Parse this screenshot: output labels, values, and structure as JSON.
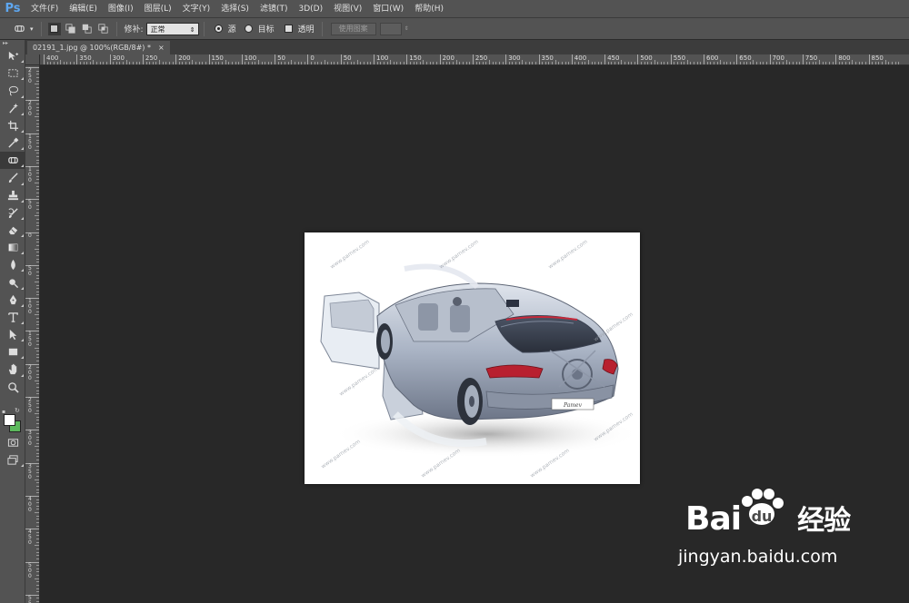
{
  "app": {
    "logo": "Ps",
    "menu": [
      "文件(F)",
      "编辑(E)",
      "图像(I)",
      "图层(L)",
      "文字(Y)",
      "选择(S)",
      "滤镜(T)",
      "3D(D)",
      "视图(V)",
      "窗口(W)",
      "帮助(H)"
    ]
  },
  "options": {
    "patch_label": "修补:",
    "patch_mode": "正常",
    "source_label": "源",
    "dest_label": "目标",
    "transparent_label": "透明",
    "use_pattern_label": "使用图案"
  },
  "document": {
    "tab_title": "02191_1.jpg @ 100%(RGB/8#) *",
    "close_glyph": "×"
  },
  "rulers": {
    "horizontal": [
      "400",
      "350",
      "300",
      "250",
      "200",
      "150",
      "100",
      "50",
      "0",
      "50",
      "100",
      "150",
      "200",
      "250",
      "300",
      "350",
      "400",
      "450",
      "500",
      "550",
      "600",
      "650",
      "700",
      "750",
      "800",
      "850"
    ],
    "vertical": [
      "2\n5\n0",
      "2\n0\n0",
      "1\n5\n0",
      "1\n0\n0",
      "5\n0",
      "0",
      "5\n0",
      "1\n0\n0",
      "1\n5\n0",
      "2\n0\n0",
      "2\n5\n0",
      "3\n0\n0",
      "3\n5\n0",
      "4\n0\n0",
      "4\n5\n0",
      "5\n0\n0",
      "5\n5\n0"
    ]
  },
  "toolbar": {
    "tools": [
      "move-tool",
      "marquee-tool",
      "lasso-tool",
      "quick-select-tool",
      "crop-tool",
      "eyedropper-tool",
      "patch-tool",
      "brush-tool",
      "clone-stamp-tool",
      "history-brush-tool",
      "eraser-tool",
      "gradient-tool",
      "blur-tool",
      "dodge-tool",
      "pen-tool",
      "type-tool",
      "path-select-tool",
      "rectangle-tool",
      "hand-tool",
      "zoom-tool"
    ],
    "foreground_color": "#ffffff",
    "background_color": "#5cb85c"
  },
  "image": {
    "watermark_text": "www.pamev.com"
  },
  "watermark": {
    "logo": "Bai du 经验",
    "url": "jingyan.baidu.com"
  }
}
